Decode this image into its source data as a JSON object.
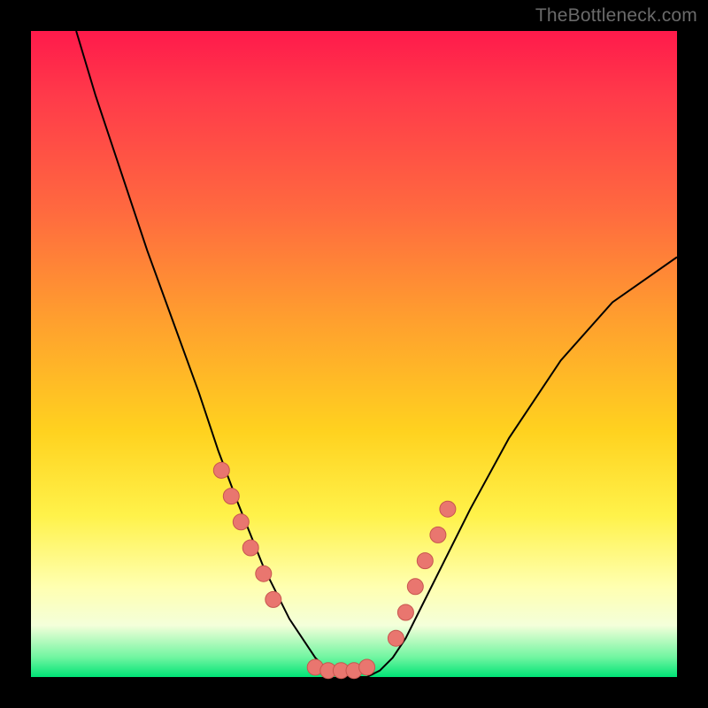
{
  "watermark": "TheBottleneck.com",
  "chart_data": {
    "type": "line",
    "title": "",
    "xlabel": "",
    "ylabel": "",
    "xlim": [
      0,
      100
    ],
    "ylim": [
      0,
      100
    ],
    "grid": false,
    "legend": false,
    "series": [
      {
        "name": "curve",
        "x": [
          7,
          10,
          14,
          18,
          22,
          26,
          29,
          32,
          34,
          36,
          38,
          40,
          42,
          44,
          46,
          48,
          50,
          52,
          54,
          56,
          58,
          60,
          64,
          68,
          74,
          82,
          90,
          100
        ],
        "y": [
          100,
          90,
          78,
          66,
          55,
          44,
          35,
          27,
          22,
          17,
          13,
          9,
          6,
          3,
          1,
          0,
          0,
          0,
          1,
          3,
          6,
          10,
          18,
          26,
          37,
          49,
          58,
          65
        ]
      }
    ],
    "markers": {
      "left_arm": {
        "x": [
          29.5,
          31,
          32.5,
          34,
          36,
          37.5
        ],
        "y": [
          32,
          28,
          24,
          20,
          16,
          12
        ]
      },
      "right_arm": {
        "x": [
          56.5,
          58,
          59.5,
          61,
          63,
          64.5
        ],
        "y": [
          6,
          10,
          14,
          18,
          22,
          26
        ]
      },
      "bottom": {
        "x": [
          44,
          46,
          48,
          50,
          52
        ],
        "y": [
          1.5,
          1,
          1,
          1,
          1.5
        ]
      }
    },
    "background_gradient": {
      "stops": [
        {
          "pos": 0.0,
          "color": "#ff1a4b"
        },
        {
          "pos": 0.1,
          "color": "#ff3a4a"
        },
        {
          "pos": 0.28,
          "color": "#ff6a3f"
        },
        {
          "pos": 0.45,
          "color": "#ffa02e"
        },
        {
          "pos": 0.62,
          "color": "#ffd21f"
        },
        {
          "pos": 0.75,
          "color": "#fff24a"
        },
        {
          "pos": 0.86,
          "color": "#ffffb0"
        },
        {
          "pos": 0.92,
          "color": "#f4ffda"
        },
        {
          "pos": 0.97,
          "color": "#6ff5a0"
        },
        {
          "pos": 1.0,
          "color": "#00e376"
        }
      ]
    }
  }
}
